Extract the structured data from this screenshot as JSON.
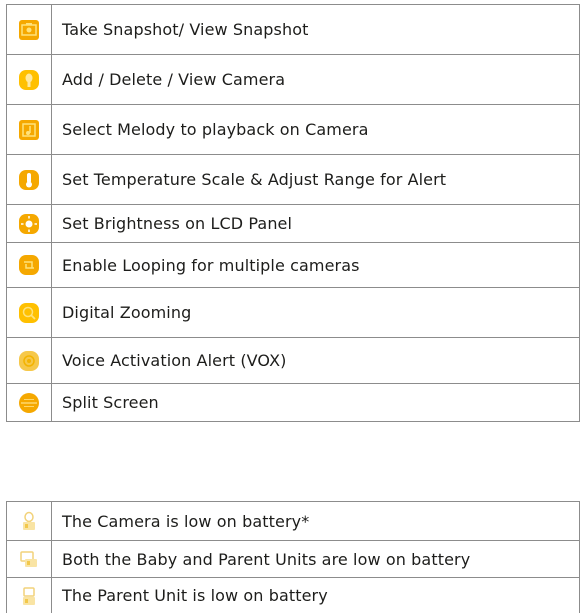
{
  "function_rows": [
    {
      "icon": "snapshot-icon",
      "label": "Take Snapshot/ View Snapshot"
    },
    {
      "icon": "camera-icon",
      "label": "Add / Delete / View Camera"
    },
    {
      "icon": "melody-icon",
      "label": "Select Melody to playback on Camera"
    },
    {
      "icon": "temperature-icon",
      "label": "Set Temperature Scale & Adjust Range for Alert"
    },
    {
      "icon": "brightness-icon",
      "label": "Set Brightness on LCD Panel"
    },
    {
      "icon": "looping-icon",
      "label": "Enable Looping for multiple cameras"
    },
    {
      "icon": "zoom-icon",
      "label": "Digital Zooming"
    },
    {
      "icon": "vox-icon",
      "label": "Voice Activation Alert (VOX)"
    },
    {
      "icon": "split-screen-icon",
      "label": "Split Screen"
    }
  ],
  "battery_rows": [
    {
      "icon": "camera-battery-icon",
      "label": "The Camera is low on battery*"
    },
    {
      "icon": "both-units-battery-icon",
      "label": "Both the Baby and Parent Units are low on battery"
    },
    {
      "icon": "parent-unit-battery-icon",
      "label": "The Parent Unit is low on battery"
    }
  ],
  "colors": {
    "icon_orange": "#f5a800",
    "icon_yellow": "#ffd200",
    "icon_pale": "#f6d77a",
    "border": "#8c8c8c",
    "text": "#1d1d1b"
  }
}
